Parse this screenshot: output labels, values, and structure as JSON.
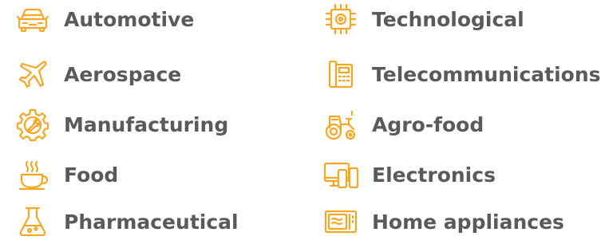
{
  "colors": {
    "icon": "#f5a623",
    "text": "#5a5a5a",
    "background": "#ffffff"
  },
  "industries": [
    {
      "label": "Automotive",
      "icon": "car-icon"
    },
    {
      "label": "Aerospace",
      "icon": "airplane-icon"
    },
    {
      "label": "Manufacturing",
      "icon": "gear-icon"
    },
    {
      "label": "Food",
      "icon": "coffee-cup-icon"
    },
    {
      "label": "Pharmaceutical",
      "icon": "flask-icon"
    },
    {
      "label": "Technological",
      "icon": "chip-icon"
    },
    {
      "label": "Telecommunications",
      "icon": "fax-phone-icon"
    },
    {
      "label": "Agro-food",
      "icon": "tractor-icon"
    },
    {
      "label": "Electronics",
      "icon": "devices-icon"
    },
    {
      "label": "Home appliances",
      "icon": "microwave-icon"
    }
  ]
}
